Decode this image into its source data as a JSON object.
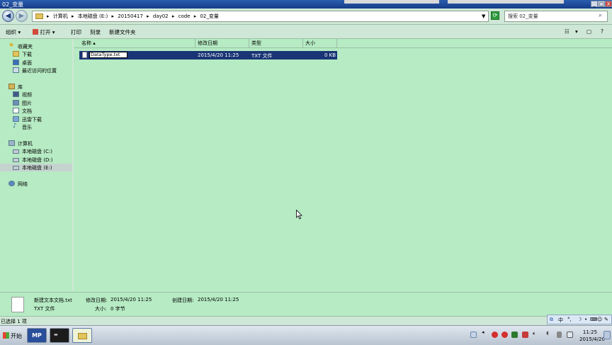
{
  "window": {
    "title": "02_变量",
    "controls": {
      "minimize": "_",
      "maximize": "□",
      "close": "X"
    },
    "inner_controls": {
      "minimize": "_",
      "maximize": "□",
      "close": "X"
    }
  },
  "address_bar": {
    "breadcrumbs": [
      "计算机",
      "本地磁盘 (E:)",
      "20150417",
      "day02",
      "code",
      "02_变量"
    ],
    "separator": "▸"
  },
  "search": {
    "placeholder": "搜索 02_变量"
  },
  "toolbar": {
    "organize": "组织",
    "open": "打开",
    "print": "打印",
    "burn": "刻录",
    "new_folder": "新建文件夹"
  },
  "nav": {
    "favorites": {
      "label": "收藏夹",
      "items": [
        "下载",
        "桌面",
        "最近访问的位置"
      ]
    },
    "libraries": {
      "label": "库",
      "items": [
        "视频",
        "图片",
        "文档",
        "迅雷下载",
        "音乐"
      ]
    },
    "computer": {
      "label": "计算机",
      "items": [
        "本地磁盘 (C:)",
        "本地磁盘 (D:)",
        "本地磁盘 (E:)"
      ]
    },
    "network": {
      "label": "网络"
    }
  },
  "columns": {
    "name": "名称",
    "modified": "修改日期",
    "type": "类型",
    "size": "大小"
  },
  "files": [
    {
      "name": "DataType.txt",
      "modified": "2015/4/20 11:25",
      "type": "TXT 文件",
      "size": "0 KB"
    }
  ],
  "details": {
    "filename": "新建文本文档.txt",
    "modified_label": "修改日期:",
    "modified": "2015/4/20 11:25",
    "created_label": "创建日期:",
    "created": "2015/4/20 11:25",
    "type": "TXT 文件",
    "size_label": "大小:",
    "size": "0 字节"
  },
  "status": {
    "text": "已选择 1 项"
  },
  "ime": {
    "lang": "中"
  },
  "taskbar": {
    "start": "开始",
    "time": "11:25",
    "date": "2015/4/20"
  },
  "colors": {
    "window_bg": "#b6ebc3",
    "selection": "#1a3575",
    "titlebar": "#2a5db0"
  }
}
